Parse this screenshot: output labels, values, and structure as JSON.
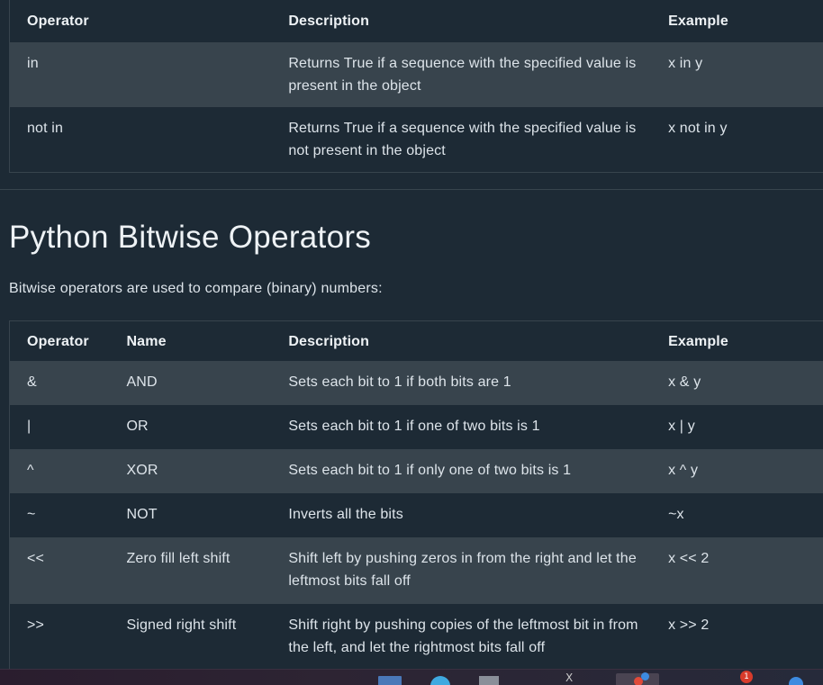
{
  "membership_table": {
    "headers": [
      "Operator",
      "Description",
      "Example"
    ],
    "rows": [
      [
        "in",
        "Returns True if a sequence with the specified value is present in the object",
        "x in y"
      ],
      [
        "not in",
        "Returns True if a sequence with the specified value is not present in the object",
        "x not in y"
      ]
    ]
  },
  "bitwise_section": {
    "title": "Python Bitwise Operators",
    "intro": "Bitwise operators are used to compare (binary) numbers:"
  },
  "bitwise_table": {
    "headers": [
      "Operator",
      "Name",
      "Description",
      "Example"
    ],
    "rows": [
      [
        "&",
        "AND",
        "Sets each bit to 1 if both bits are 1",
        "x & y"
      ],
      [
        "|",
        "OR",
        "Sets each bit to 1 if one of two bits is 1",
        "x | y"
      ],
      [
        "^",
        "XOR",
        "Sets each bit to 1 if only one of two bits is 1",
        "x ^ y"
      ],
      [
        "~",
        "NOT",
        "Inverts all the bits",
        "~x"
      ],
      [
        "<<",
        "Zero fill left shift",
        "Shift left by pushing zeros in from the right and let the leftmost bits fall off",
        "x << 2"
      ],
      [
        ">>",
        "Signed right shift",
        "Shift right by pushing copies of the leftmost bit in from the left, and let the rightmost bits fall off",
        "x >> 2"
      ]
    ]
  },
  "taskbar": {
    "notification_badge": "1",
    "close_glyph": "X"
  },
  "colors": {
    "background": "#1d2a35",
    "row_alt": "#38444d",
    "text": "#dde4ea"
  }
}
